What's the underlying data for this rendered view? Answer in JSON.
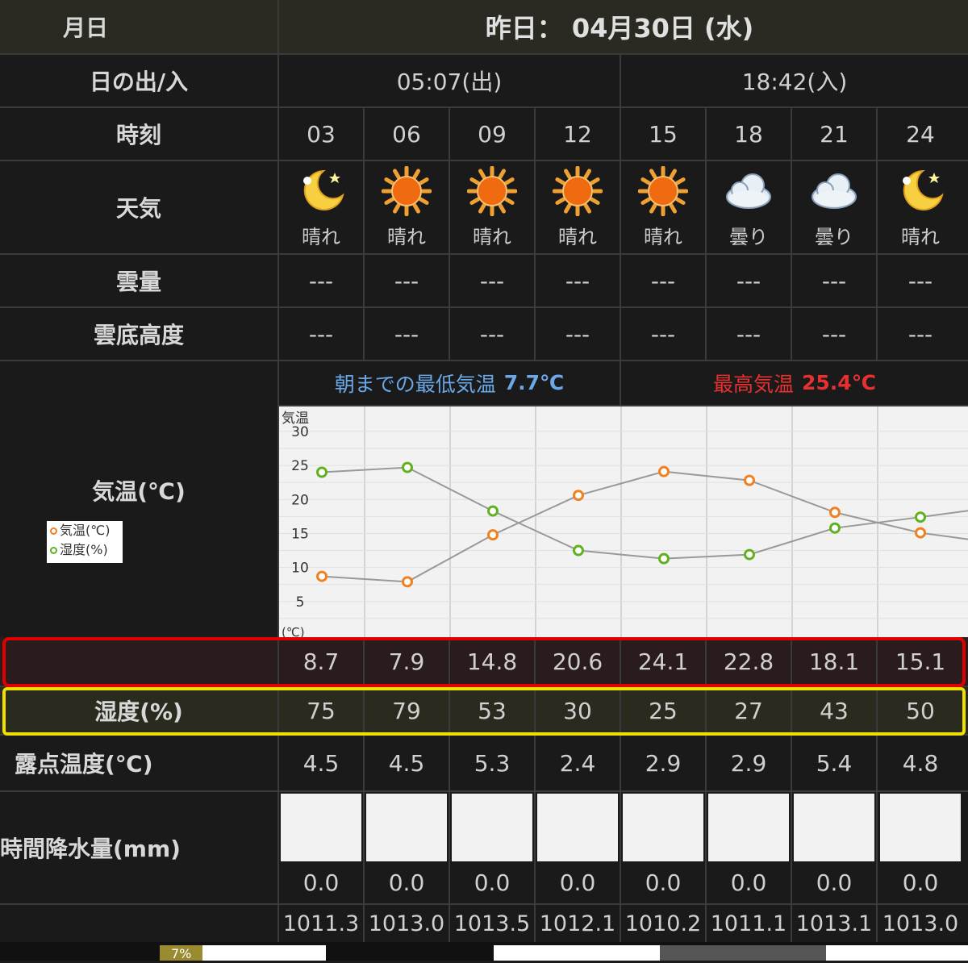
{
  "header": {
    "date_label": "月日",
    "date_value": "昨日： 04月30日 (水)"
  },
  "sun": {
    "label": "日の出/入",
    "sunrise": "05:07(出)",
    "sunset": "18:42(入)"
  },
  "time": {
    "label": "時刻",
    "hours": [
      "03",
      "06",
      "09",
      "12",
      "15",
      "18",
      "21",
      "24"
    ]
  },
  "weather": {
    "label": "天気",
    "items": [
      {
        "icon": "moon-clear-icon",
        "text": "晴れ"
      },
      {
        "icon": "sun-icon",
        "text": "晴れ"
      },
      {
        "icon": "sun-icon",
        "text": "晴れ"
      },
      {
        "icon": "sun-icon",
        "text": "晴れ"
      },
      {
        "icon": "sun-icon",
        "text": "晴れ"
      },
      {
        "icon": "cloud-icon",
        "text": "曇り"
      },
      {
        "icon": "cloud-icon",
        "text": "曇り"
      },
      {
        "icon": "moon-clear-icon",
        "text": "晴れ"
      }
    ]
  },
  "cloud_amount": {
    "label": "雲量",
    "values": [
      "---",
      "---",
      "---",
      "---",
      "---",
      "---",
      "---",
      "---"
    ]
  },
  "cloud_base": {
    "label": "雲底高度",
    "values": [
      "---",
      "---",
      "---",
      "---",
      "---",
      "---",
      "---",
      "---"
    ]
  },
  "temp_section": {
    "label": "気温(℃)",
    "min_label": "朝までの最低気温",
    "min_value": "7.7℃",
    "max_label": "最高気温",
    "max_value": "25.4℃",
    "legend_temp": "気温(℃)",
    "legend_humidity": "湿度(%)",
    "colors": {
      "temp": "#f08020",
      "humidity": "#60b020",
      "min": "#6aa8e8",
      "max": "#e83030"
    }
  },
  "chart_data": {
    "type": "line",
    "ylabel": "気温",
    "yunit": "(℃)",
    "ylim": [
      0,
      32
    ],
    "yticks": [
      5,
      10,
      15,
      20,
      25,
      30
    ],
    "x": [
      "03",
      "06",
      "09",
      "12",
      "15",
      "18",
      "21",
      "24"
    ],
    "series": [
      {
        "name": "気温(℃)",
        "values": [
          8.7,
          7.9,
          14.8,
          20.6,
          24.1,
          22.8,
          18.1,
          15.1
        ]
      },
      {
        "name": "湿度(%)",
        "values": [
          24,
          24.7,
          18.3,
          12.5,
          11.3,
          11.9,
          15.8,
          17.4
        ]
      }
    ],
    "grid": true
  },
  "temp_values": [
    "8.7",
    "7.9",
    "14.8",
    "20.6",
    "24.1",
    "22.8",
    "18.1",
    "15.1"
  ],
  "humidity": {
    "label": "湿度(%)",
    "values": [
      "75",
      "79",
      "53",
      "30",
      "25",
      "27",
      "43",
      "50"
    ]
  },
  "dewpoint": {
    "label": "露点温度(℃)",
    "values": [
      "4.5",
      "4.5",
      "5.3",
      "2.4",
      "2.9",
      "2.9",
      "5.4",
      "4.8"
    ]
  },
  "precip": {
    "label": "時間降水量(mm)",
    "values": [
      "0.0",
      "0.0",
      "0.0",
      "0.0",
      "0.0",
      "0.0",
      "0.0",
      "0.0"
    ]
  },
  "pressure": {
    "values": [
      "1011.3",
      "1013.0",
      "1013.5",
      "1012.1",
      "1010.2",
      "1011.1",
      "1013.1",
      "1013.0"
    ]
  },
  "bottom": {
    "badge": "7%"
  }
}
